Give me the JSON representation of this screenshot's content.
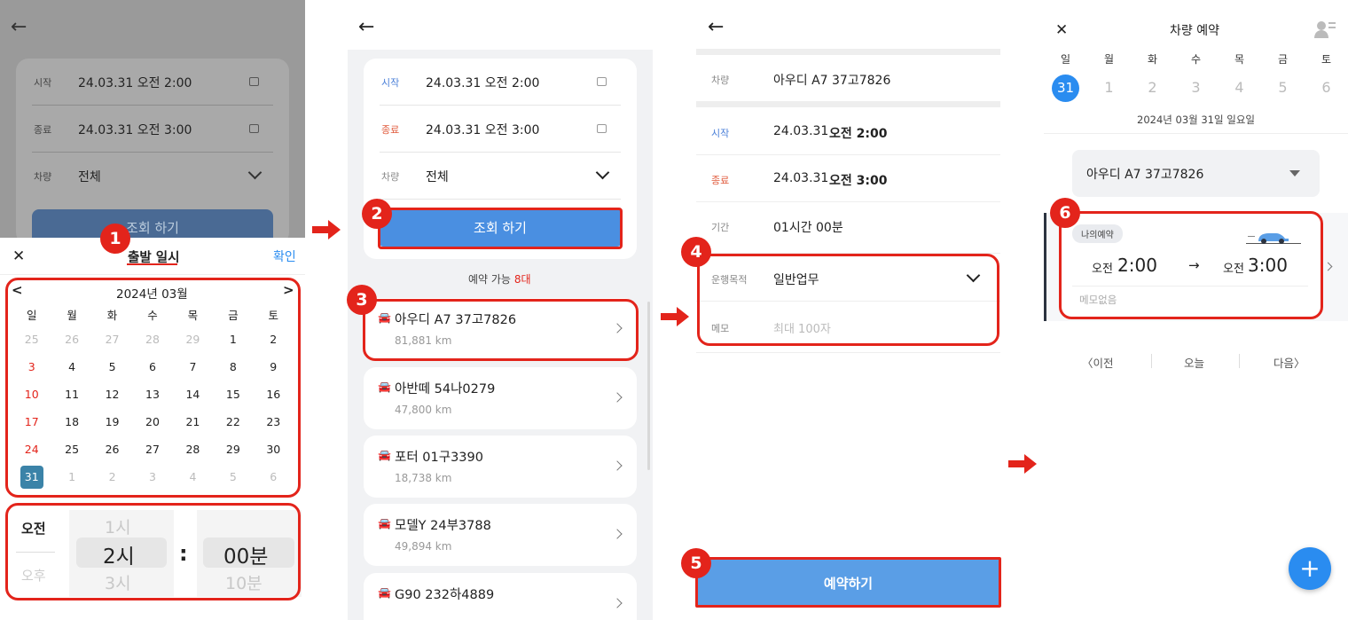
{
  "colors": {
    "accent_red": "#e3241b",
    "blue_button": "#4a8fe1",
    "blue_day": "#2a8cf0"
  },
  "panel1": {
    "form": {
      "start_label": "시작",
      "start_value": "24.03.31 오전 2:00",
      "end_label": "종료",
      "end_value": "24.03.31 오전 3:00",
      "car_label": "차량",
      "car_value": "전체",
      "search_button": "조회 하기"
    },
    "sheet": {
      "close": "✕",
      "title": "출발 일시",
      "confirm": "확인",
      "month": "2024년 03월",
      "weekdays": [
        "일",
        "월",
        "화",
        "수",
        "목",
        "금",
        "토"
      ],
      "days": [
        "25",
        "26",
        "27",
        "28",
        "29",
        "1",
        "2",
        "3",
        "4",
        "5",
        "6",
        "7",
        "8",
        "9",
        "10",
        "11",
        "12",
        "13",
        "14",
        "15",
        "16",
        "17",
        "18",
        "19",
        "20",
        "21",
        "22",
        "23",
        "24",
        "25",
        "26",
        "27",
        "28",
        "29",
        "30",
        "31",
        "1",
        "2",
        "3",
        "4",
        "5",
        "6"
      ],
      "ampm": [
        "오전",
        "오후"
      ],
      "hours": [
        "1시",
        "2시",
        "3시"
      ],
      "colon": ":",
      "minutes": [
        "00분",
        "10분"
      ]
    }
  },
  "panel2": {
    "form": {
      "start_label": "시작",
      "start_value": "24.03.31 오전 2:00",
      "end_label": "종료",
      "end_value": "24.03.31 오전 3:00",
      "car_label": "차량",
      "car_value": "전체",
      "search_button": "조회 하기"
    },
    "available_label": "예약 가능",
    "available_count": "8대",
    "cars": [
      {
        "name": "아우디 A7 37고7826",
        "km": "81,881 km"
      },
      {
        "name": "아반떼 54나0279",
        "km": "47,800 km"
      },
      {
        "name": "포터 01구3390",
        "km": "18,738 km"
      },
      {
        "name": "모델Y 24부3788",
        "km": "49,894 km"
      },
      {
        "name": "G90 232하4889",
        "km": ""
      }
    ]
  },
  "panel3": {
    "car_label": "차량",
    "car_value": "아우디 A7 37고7826",
    "start_label": "시작",
    "start_date": "24.03.31",
    "start_time": "오전 2:00",
    "end_label": "종료",
    "end_date": "24.03.31",
    "end_time": "오전 3:00",
    "duration_label": "기간",
    "duration_value": "01시간 00분",
    "purpose_label": "운행목적",
    "purpose_value": "일반업무",
    "memo_label": "메모",
    "memo_placeholder": "최대 100자",
    "reserve_button": "예약하기"
  },
  "panel4": {
    "close": "✕",
    "title": "차량 예약",
    "weekdays": [
      "일",
      "월",
      "화",
      "수",
      "목",
      "금",
      "토"
    ],
    "dates": [
      "31",
      "1",
      "2",
      "3",
      "4",
      "5",
      "6"
    ],
    "full_date": "2024년 03월 31일 일요일",
    "car_select": "아우디 A7 37고7826",
    "reservation": {
      "tag": "나의예약",
      "start_ampm": "오전",
      "start_time": "2:00",
      "arrow": "→",
      "end_ampm": "오전",
      "end_time": "3:00",
      "memo": "메모없음"
    },
    "nav": {
      "prev": "이전",
      "today": "오늘",
      "next": "다음"
    },
    "fab": "+"
  },
  "badges": [
    "1",
    "2",
    "3",
    "4",
    "5",
    "6"
  ]
}
